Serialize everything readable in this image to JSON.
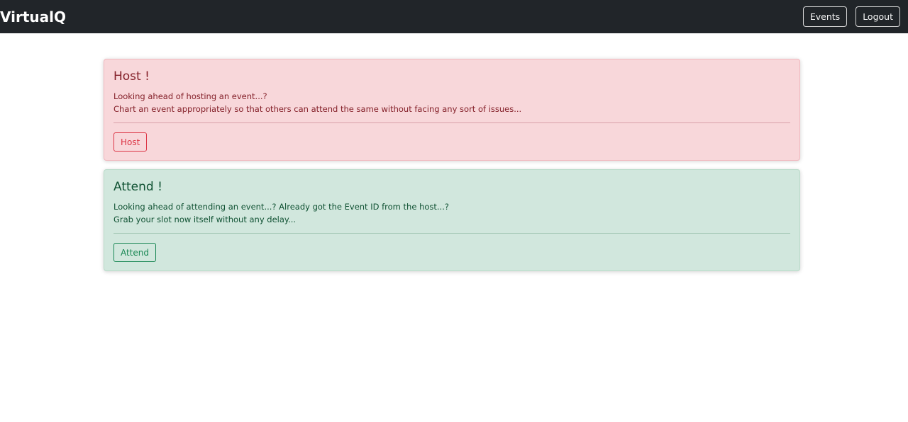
{
  "navbar": {
    "brand": "VirtualQ",
    "events_label": "Events",
    "logout_label": "Logout"
  },
  "cards": [
    {
      "title": "Host !",
      "lines": [
        "Looking ahead of hosting an event...?",
        "Chart an event appropriately so that others can attend the same without facing any sort of issues..."
      ],
      "button_label": "Host"
    },
    {
      "title": "Attend !",
      "lines": [
        "Looking ahead of attending an event...? Already got the Event ID from the host...?",
        "Grab your slot now itself without any delay..."
      ],
      "button_label": "Attend"
    }
  ],
  "colors": {
    "navbar_bg": "#212529",
    "host_bg": "#f8d7da",
    "host_text": "#842029",
    "host_accent": "#dc3545",
    "attend_bg": "#d1e7dd",
    "attend_text": "#0f5132",
    "attend_accent": "#198754"
  }
}
